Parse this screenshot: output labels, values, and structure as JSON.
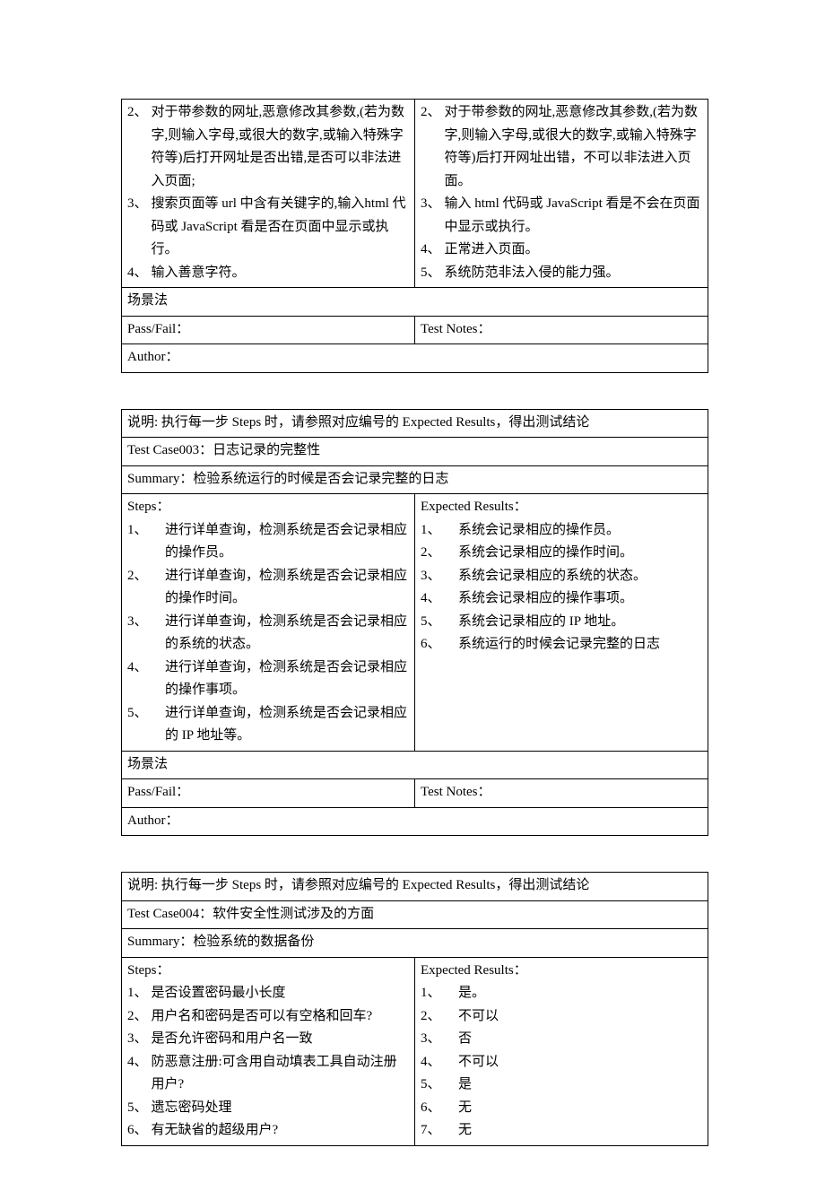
{
  "table1": {
    "left_items": [
      {
        "n": "2、",
        "t": "对于带参数的网址,恶意修改其参数,(若为数字,则输入字母,或很大的数字,或输入特殊字符等)后打开网址是否出错,是否可以非法进入页面;"
      },
      {
        "n": "3、",
        "t": "搜索页面等 url 中含有关键字的,输入html 代码或 JavaScript 看是否在页面中显示或执行。"
      },
      {
        "n": "4、",
        "t": "输入善意字符。"
      }
    ],
    "right_items": [
      {
        "n": "2、",
        "t": "对于带参数的网址,恶意修改其参数,(若为数字,则输入字母,或很大的数字,或输入特殊字符等)后打开网址出错，不可以非法进入页面。"
      },
      {
        "n": "3、",
        "t": "输入 html 代码或 JavaScript 看是不会在页面中显示或执行。"
      },
      {
        "n": "4、",
        "t": "正常进入页面。"
      },
      {
        "n": "5、",
        "t": "系统防范非法入侵的能力强。"
      }
    ],
    "method": "场景法",
    "passfail": "Pass/Fail：",
    "testnotes": "Test Notes：",
    "author": "Author："
  },
  "table2": {
    "note": "说明: 执行每一步 Steps 时，请参照对应编号的 Expected Results，得出测试结论",
    "caseid": "Test Case003：日志记录的完整性",
    "summary": "Summary：检验系统运行的时候是否会记录完整的日志",
    "steps_label": "Steps：",
    "er_label": "Expected Results：",
    "steps": [
      {
        "n": "1、",
        "t": "进行详单查询，检测系统是否会记录相应的操作员。"
      },
      {
        "n": "2、",
        "t": "进行详单查询，检测系统是否会记录相应的操作时间。"
      },
      {
        "n": "3、",
        "t": "进行详单查询，检测系统是否会记录相应的系统的状态。"
      },
      {
        "n": "4、",
        "t": "进行详单查询，检测系统是否会记录相应的操作事项。"
      },
      {
        "n": "5、",
        "t": "进行详单查询，检测系统是否会记录相应的 IP 地址等。"
      }
    ],
    "results": [
      {
        "n": "1、",
        "t": "系统会记录相应的操作员。"
      },
      {
        "n": "2、",
        "t": "系统会记录相应的操作时间。"
      },
      {
        "n": "3、",
        "t": "系统会记录相应的系统的状态。"
      },
      {
        "n": "4、",
        "t": "系统会记录相应的操作事项。"
      },
      {
        "n": "5、",
        "t": "系统会记录相应的 IP 地址。"
      },
      {
        "n": "6、",
        "t": "系统运行的时候会记录完整的日志"
      }
    ],
    "method": "场景法",
    "passfail": "Pass/Fail：",
    "testnotes": "Test Notes：",
    "author": "Author："
  },
  "table3": {
    "note": "说明: 执行每一步 Steps 时，请参照对应编号的 Expected Results，得出测试结论",
    "caseid": "Test Case004：软件安全性测试涉及的方面",
    "summary": "Summary：检验系统的数据备份",
    "steps_label": "Steps：",
    "er_label": "Expected Results：",
    "steps": [
      {
        "n": "1、",
        "t": "是否设置密码最小长度"
      },
      {
        "n": "2、",
        "t": "用户名和密码是否可以有空格和回车?"
      },
      {
        "n": "3、",
        "t": "是否允许密码和用户名一致"
      },
      {
        "n": "4、",
        "t": "防恶意注册:可含用自动填表工具自动注册用户?"
      },
      {
        "n": "5、",
        "t": "遗忘密码处理"
      },
      {
        "n": "6、",
        "t": "有无缺省的超级用户?"
      }
    ],
    "results": [
      {
        "n": "1、",
        "t": "是。"
      },
      {
        "n": "2、",
        "t": "不可以"
      },
      {
        "n": "3、",
        "t": "否"
      },
      {
        "n": "4、",
        "t": "不可以"
      },
      {
        "n": "5、",
        "t": "是"
      },
      {
        "n": "6、",
        "t": "无"
      },
      {
        "n": "7、",
        "t": "无"
      }
    ]
  }
}
